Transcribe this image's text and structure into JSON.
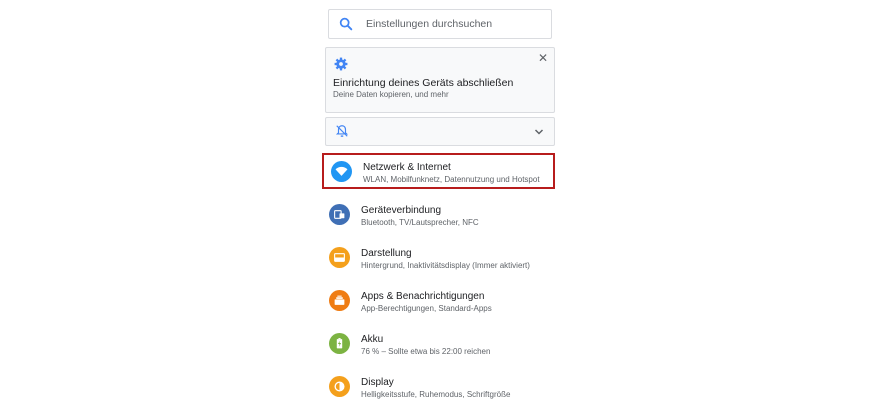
{
  "search": {
    "placeholder": "Einstellungen durchsuchen",
    "icon": "search-icon"
  },
  "setup_card": {
    "title": "Einrichtung deines Geräts abschließen",
    "subtitle": "Deine Daten kopieren,  und mehr",
    "icon": "gear-icon",
    "close_icon": "close-icon"
  },
  "dnd_bar": {
    "icon": "notifications-off-icon",
    "expand_icon": "chevron-down-icon"
  },
  "settings": [
    {
      "label": "Netzwerk & Internet",
      "desc": "WLAN, Mobilfunknetz, Datennutzung und Hotspot",
      "icon": "wifi-icon",
      "color": "#2196f3",
      "highlighted": true
    },
    {
      "label": "Geräteverbindung",
      "desc": "Bluetooth, TV/Lautsprecher, NFC",
      "icon": "devices-icon",
      "color": "#3f6fb5"
    },
    {
      "label": "Darstellung",
      "desc": "Hintergrund, Inaktivitätsdisplay (Immer aktiviert)",
      "icon": "display-style-icon",
      "color": "#f4a01c"
    },
    {
      "label": "Apps & Benachrichtigungen",
      "desc": "App-Berechtigungen, Standard-Apps",
      "icon": "apps-icon",
      "color": "#ef7c13"
    },
    {
      "label": "Akku",
      "desc": "76 % – Sollte etwa bis 22:00 reichen",
      "icon": "battery-icon",
      "color": "#7cb342"
    },
    {
      "label": "Display",
      "desc": "Helligkeitsstufe, Ruhemodus, Schriftgröße",
      "icon": "brightness-icon",
      "color": "#f4a01c"
    }
  ],
  "colors": {
    "accent": "#4285f4",
    "highlight_border": "#b71c1c"
  }
}
